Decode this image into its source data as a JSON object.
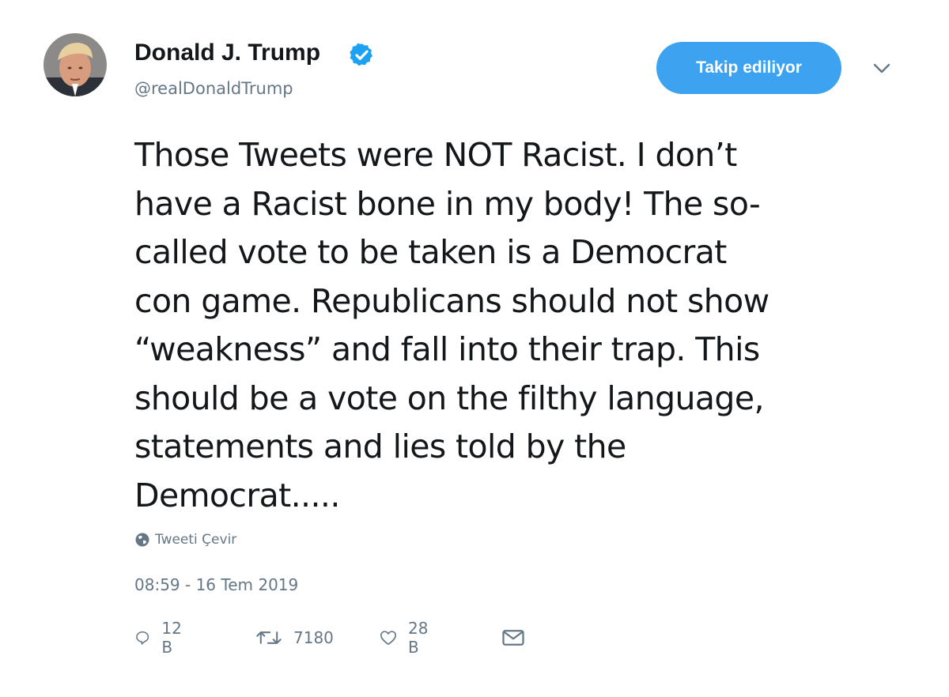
{
  "author": {
    "name": "Donald J. Trump",
    "handle": "@realDonaldTrump",
    "verified": true
  },
  "follow_button": {
    "label": "Takip ediliyor"
  },
  "tweet": {
    "text_lines": [
      "Those Tweets were NOT Racist. I don’t",
      "have a Racist bone in my body! The so-",
      "called vote to be taken is a Democrat",
      "con game. Republicans should not show",
      "“weakness” and fall into their trap. This",
      "should be a vote on the filthy language,",
      "statements and lies told by the",
      "Democrat....."
    ],
    "translate_label": "Tweeti Çevir",
    "timestamp": "08:59 - 16 Tem 2019"
  },
  "actions": {
    "replies": "12 B",
    "retweets": "7180",
    "likes": "28 B"
  },
  "colors": {
    "accent": "#3da2f0",
    "secondary_text": "#657786",
    "primary_text": "#14171a"
  },
  "icons": {
    "verified": "verified-badge-icon",
    "more": "chevron-down-icon",
    "translate": "globe-icon",
    "reply": "reply-icon",
    "retweet": "retweet-icon",
    "like": "heart-icon",
    "dm": "envelope-icon"
  }
}
